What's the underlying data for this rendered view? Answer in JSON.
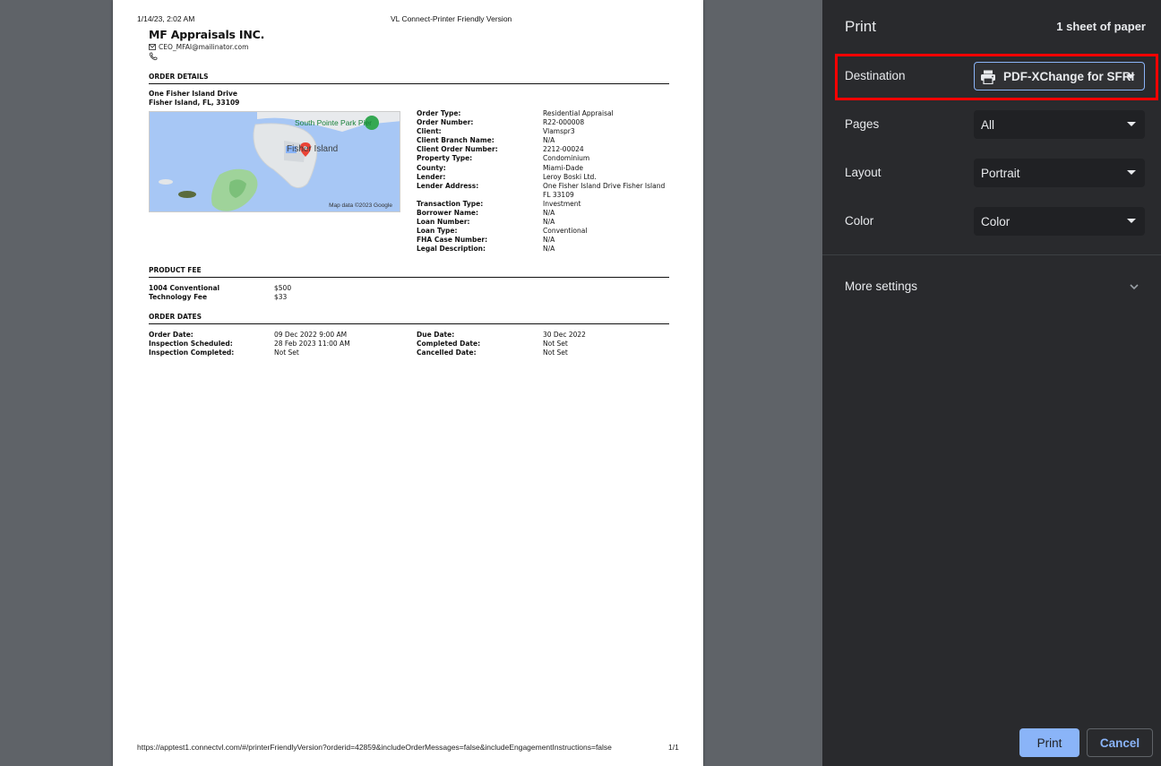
{
  "preview": {
    "header_datetime": "1/14/23, 2:02 AM",
    "header_title": "VL Connect-Printer Friendly Version",
    "company_name": "MF Appraisals INC.",
    "company_email": "CEO_MFAI@mailinator.com",
    "order_details_title": "ORDER DETAILS",
    "address_line1": "One Fisher Island Drive",
    "address_line2": "Fisher Island, FL, 33109",
    "map": {
      "label_park": "South Pointe Park Pier",
      "label_island": "Fisher Island",
      "attribution": "Map data ©2023 Google"
    },
    "order_fields": [
      {
        "key": "Order Type:",
        "value": "Residential Appraisal"
      },
      {
        "key": "Order Number:",
        "value": "R22-000008"
      },
      {
        "key": "Client:",
        "value": "Vlamspr3"
      },
      {
        "key": "Client Branch Name:",
        "value": "N/A"
      },
      {
        "key": "Client Order Number:",
        "value": "2212-00024"
      },
      {
        "key": "Property Type:",
        "value": "Condominium"
      },
      {
        "key": "County:",
        "value": "Miami-Dade"
      },
      {
        "key": "Lender:",
        "value": "Leroy Boski Ltd."
      },
      {
        "key": "Lender Address:",
        "value": "One Fisher Island Drive Fisher Island"
      },
      {
        "key": "",
        "value": "FL 33109"
      },
      {
        "key": "Transaction Type:",
        "value": "Investment"
      },
      {
        "key": "Borrower Name:",
        "value": "N/A"
      },
      {
        "key": "Loan Number:",
        "value": "N/A"
      },
      {
        "key": "Loan Type:",
        "value": "Conventional"
      },
      {
        "key": "FHA Case Number:",
        "value": "N/A"
      },
      {
        "key": "Legal Description:",
        "value": "N/A"
      }
    ],
    "product_fee_title": "PRODUCT FEE",
    "product_fees": [
      {
        "key": "1004 Conventional",
        "value": "$500"
      },
      {
        "key": "Technology Fee",
        "value": "$33"
      }
    ],
    "order_dates_title": "ORDER DATES",
    "dates_left": [
      {
        "key": "Order Date:",
        "value": "09 Dec 2022 9:00 AM"
      },
      {
        "key": "Inspection Scheduled:",
        "value": "28 Feb 2023 11:00 AM"
      },
      {
        "key": "Inspection Completed:",
        "value": "Not Set"
      }
    ],
    "dates_right": [
      {
        "key": "Due Date:",
        "value": "30 Dec 2022"
      },
      {
        "key": "Completed Date:",
        "value": "Not Set"
      },
      {
        "key": "Cancelled Date:",
        "value": "Not Set"
      }
    ],
    "footer_url": "https://apptest1.connectvl.com/#/printerFriendlyVersion?orderid=42859&includeOrderMessages=false&includeEngagementInstructions=false",
    "footer_page": "1/1"
  },
  "sidebar": {
    "title": "Print",
    "sheet_count": "1 sheet of paper",
    "destination_label": "Destination",
    "destination_value": "PDF-XChange for SFRI",
    "pages_label": "Pages",
    "pages_value": "All",
    "layout_label": "Layout",
    "layout_value": "Portrait",
    "color_label": "Color",
    "color_value": "Color",
    "more_settings": "More settings",
    "print_button": "Print",
    "cancel_button": "Cancel"
  },
  "colors": {
    "accent": "#8ab4f8",
    "sidebar_bg": "#292a2d",
    "highlight": "#ff0000"
  },
  "icons": {
    "destination": "printer-icon",
    "email": "envelope-icon",
    "phone": "phone-icon",
    "more_settings": "chevron-down-icon"
  }
}
